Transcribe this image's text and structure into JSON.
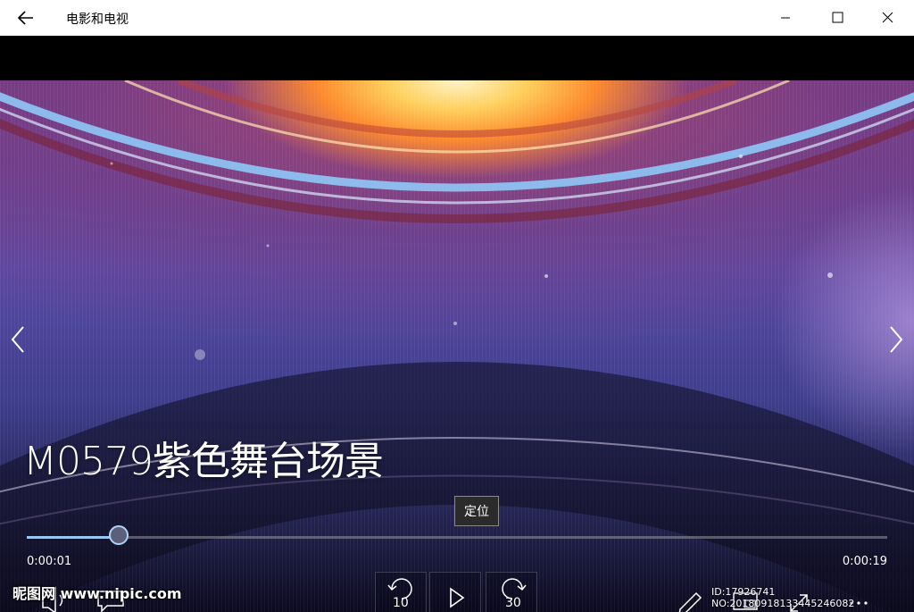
{
  "window": {
    "title": "电影和电视",
    "back_icon": "back-arrow-icon",
    "minimize_icon": "minimize-icon",
    "maximize_icon": "maximize-icon",
    "close_icon": "close-icon"
  },
  "video": {
    "title": "M0579紫色舞台场景",
    "tooltip": "定位",
    "current_time": "0:00:01",
    "total_time": "0:00:19",
    "progress_fraction": 0.107
  },
  "controls": {
    "skip_back_label": "10",
    "skip_forward_label": "30",
    "icons": [
      "volume-icon",
      "subtitles-icon",
      "skip-back-icon",
      "play-icon",
      "skip-forward-icon",
      "edit-icon",
      "mini-view-icon",
      "fullscreen-icon",
      "more-icon"
    ]
  },
  "watermark": {
    "left": "昵图网 www.nipic.com",
    "right": "ID:17926741 NO:20180918133445246082"
  },
  "colors": {
    "seek_fill": "#9cc7f4",
    "titlebar_bg": "#ffffff",
    "stage_purple": "#5a4aa6"
  }
}
